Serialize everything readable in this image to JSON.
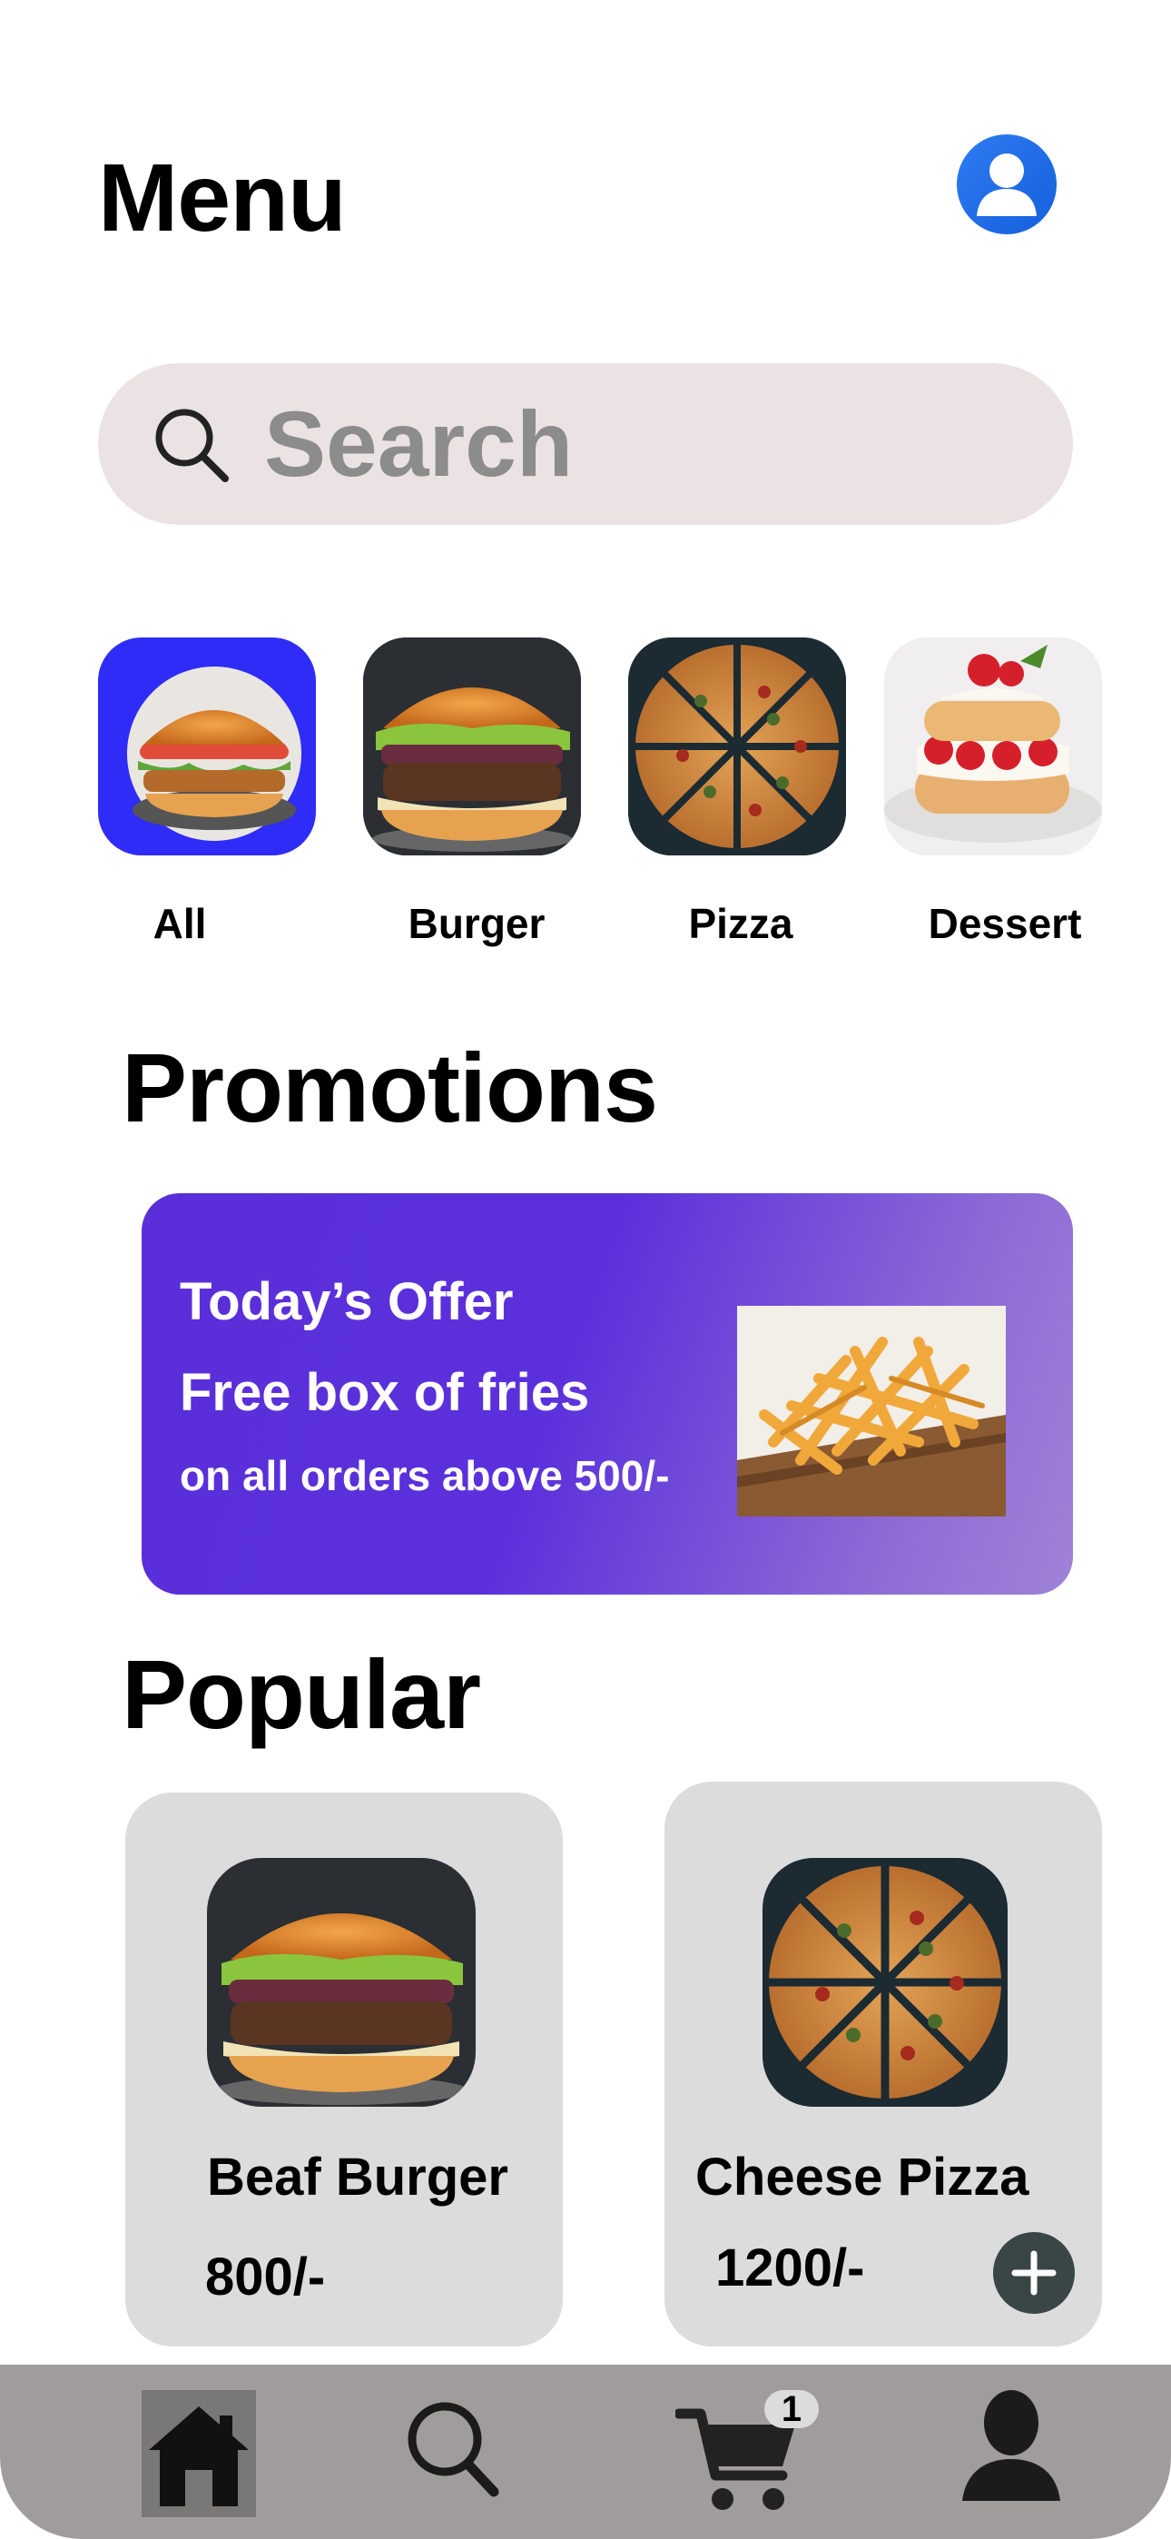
{
  "header": {
    "title": "Menu"
  },
  "search": {
    "placeholder": "Search"
  },
  "categories": [
    {
      "label": "All",
      "active": true
    },
    {
      "label": "Burger",
      "active": false
    },
    {
      "label": "Pizza",
      "active": false
    },
    {
      "label": "Dessert",
      "active": false
    }
  ],
  "promotions": {
    "title": "Promotions",
    "offer_title": "Today’s Offer",
    "offer_line": "Free box of fries",
    "offer_condition": "on all orders above 500/-"
  },
  "popular": {
    "title": "Popular",
    "items": [
      {
        "name": "Beaf Burger",
        "price": "800/-"
      },
      {
        "name": "Cheese Pizza",
        "price": "1200/-"
      }
    ]
  },
  "bottom_nav": {
    "items": [
      "home-icon",
      "search-icon",
      "cart-icon",
      "profile-icon"
    ],
    "cart_count": "1"
  },
  "colors": {
    "accent_blue": "#2f2cf7",
    "promo_start": "#5a2fd9",
    "promo_end": "#9f82d7",
    "nav_bg": "#a19c9c",
    "card_bg": "#dcdcdc"
  }
}
